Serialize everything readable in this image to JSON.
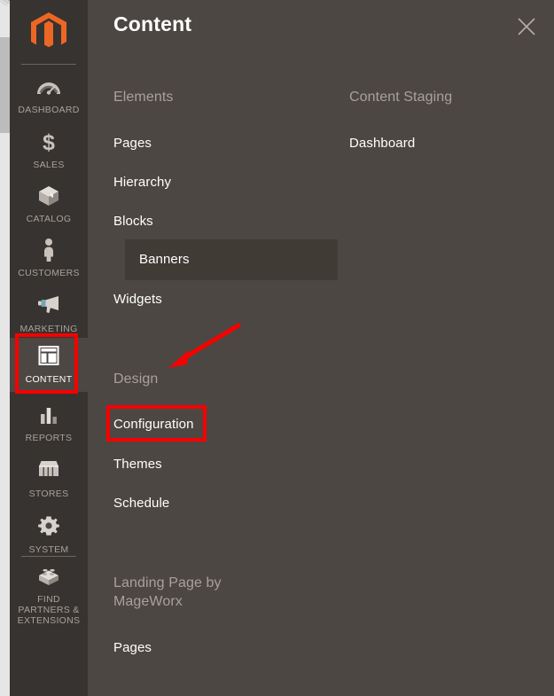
{
  "browser": {
    "scrollbar_name": "page-scrollbar"
  },
  "sidebar": {
    "logo_label": "Magento",
    "items": [
      {
        "label": "DASHBOARD",
        "icon": "dashboard-gauge-icon",
        "active": false
      },
      {
        "label": "SALES",
        "icon": "dollar-sign-icon",
        "active": false
      },
      {
        "label": "CATALOG",
        "icon": "box-icon",
        "active": false
      },
      {
        "label": "CUSTOMERS",
        "icon": "person-icon",
        "active": false
      },
      {
        "label": "MARKETING",
        "icon": "megaphone-icon",
        "active": false
      },
      {
        "label": "CONTENT",
        "icon": "layout-window-icon",
        "active": true
      },
      {
        "label": "REPORTS",
        "icon": "bar-chart-icon",
        "active": false
      },
      {
        "label": "STORES",
        "icon": "storefront-icon",
        "active": false
      },
      {
        "label": "SYSTEM",
        "icon": "gear-icon",
        "active": false
      },
      {
        "label": "FIND PARTNERS & EXTENSIONS",
        "icon": "lego-brick-icon",
        "active": false
      }
    ]
  },
  "flyout": {
    "title": "Content",
    "close_label": "×",
    "groups": [
      {
        "title": "Elements",
        "items": [
          {
            "label": "Pages",
            "hovered": false
          },
          {
            "label": "Hierarchy",
            "hovered": false
          },
          {
            "label": "Blocks",
            "hovered": false
          },
          {
            "label": "Banners",
            "hovered": true
          },
          {
            "label": "Widgets",
            "hovered": false
          }
        ]
      },
      {
        "title": "Design",
        "items": [
          {
            "label": "Configuration",
            "hovered": false
          },
          {
            "label": "Themes",
            "hovered": false
          },
          {
            "label": "Schedule",
            "hovered": false
          }
        ]
      },
      {
        "title": "Landing Page by MageWorx",
        "items": [
          {
            "label": "Pages",
            "hovered": false
          }
        ]
      },
      {
        "title": "Content Staging",
        "items": [
          {
            "label": "Dashboard",
            "hovered": false
          }
        ]
      }
    ]
  },
  "annotations": {
    "highlight_color": "#f70000",
    "boxes": [
      {
        "name": "content-nav-highlight",
        "target": "CONTENT"
      },
      {
        "name": "configuration-highlight",
        "target": "Configuration"
      }
    ],
    "arrow": {
      "name": "pointer-arrow",
      "points_to": "Design / Configuration"
    }
  },
  "colors": {
    "sidebar_bg": "#373330",
    "panel_bg": "#4c4742",
    "accent_orange": "#ec6625",
    "muted_text": "#a9a19b",
    "active_item_bg": "#413b36"
  }
}
